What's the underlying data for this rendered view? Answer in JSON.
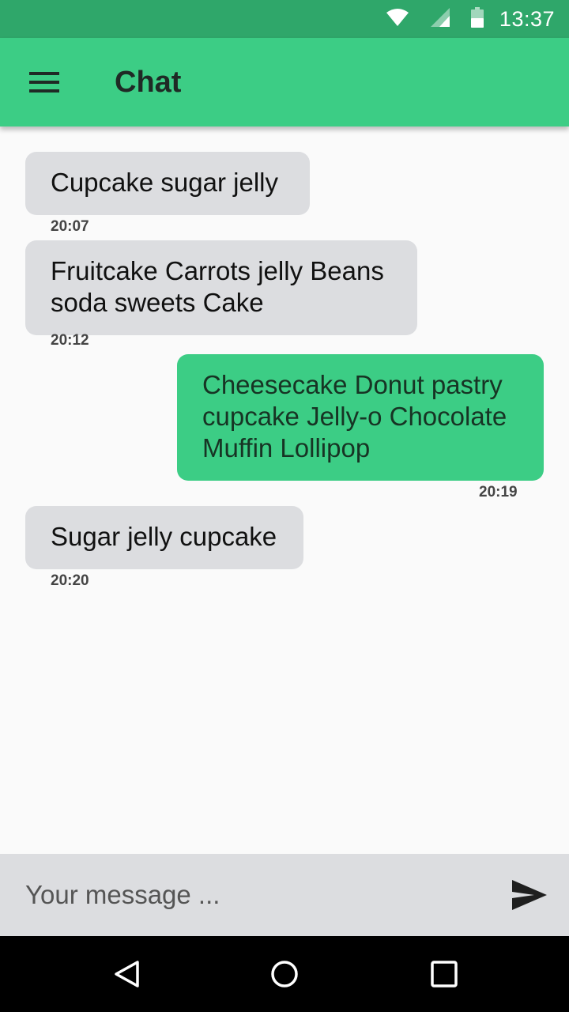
{
  "status_bar": {
    "time": "13:37",
    "icons": [
      "wifi-icon",
      "cell-signal-icon",
      "battery-icon"
    ],
    "color": "#2fa76a"
  },
  "app_bar": {
    "title": "Chat",
    "menu_icon": "hamburger-menu-icon",
    "color": "#3ccd85"
  },
  "messages": [
    {
      "direction": "incoming",
      "text": "Cupcake sugar jelly",
      "time": "20:07"
    },
    {
      "direction": "incoming",
      "text": "Fruitcake Carrots jelly Beans soda sweets Cake",
      "time": "20:12"
    },
    {
      "direction": "outgoing",
      "text": "Cheesecake Donut pastry cupcake Jelly-o Chocolate Muffin Lollipop",
      "time": "20:19"
    },
    {
      "direction": "incoming",
      "text": "Sugar jelly cupcake",
      "time": "20:20"
    }
  ],
  "composer": {
    "placeholder": "Your message ...",
    "value": "",
    "send_icon": "send-icon"
  },
  "nav_bar": {
    "icons": [
      "back-icon",
      "home-icon",
      "recents-icon"
    ]
  },
  "colors": {
    "incoming_bubble": "#dcdde0",
    "outgoing_bubble": "#3ccd85",
    "background": "#fafafa"
  }
}
